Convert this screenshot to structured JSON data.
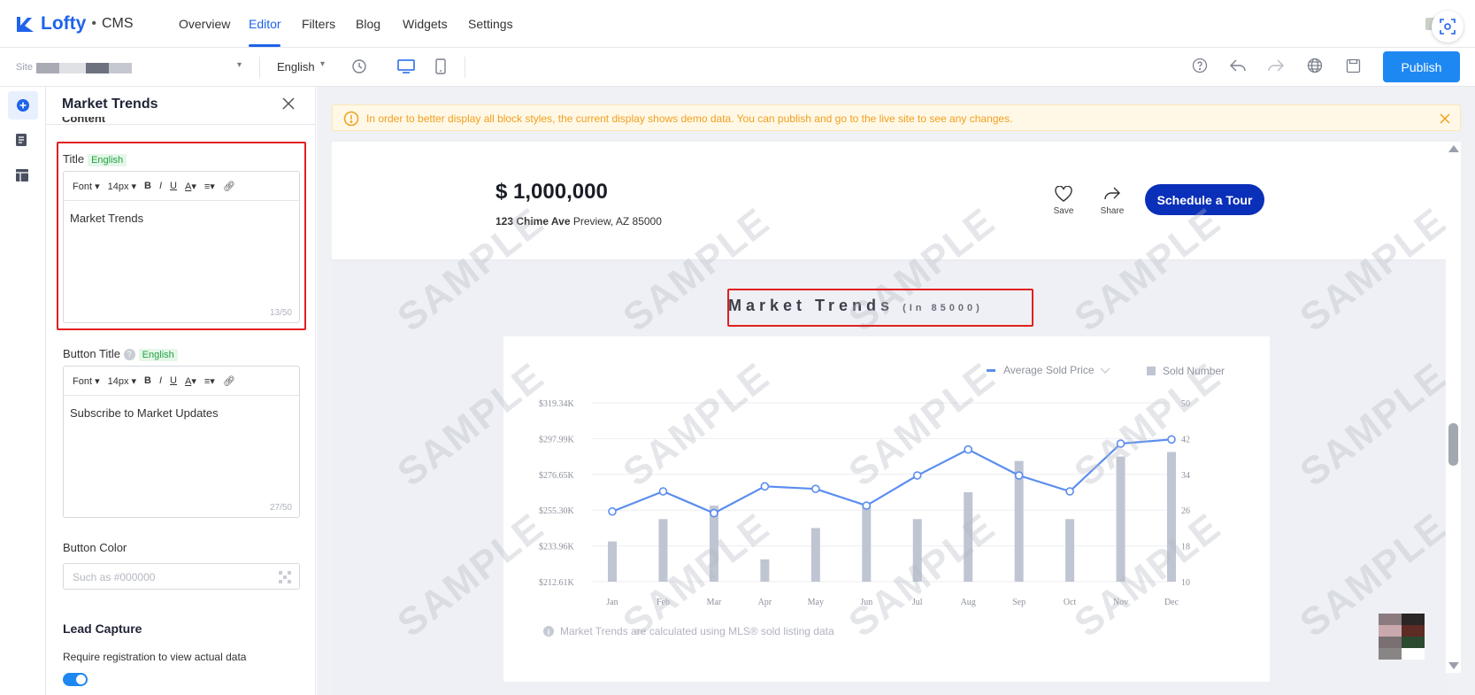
{
  "app": {
    "brand": "Lofty",
    "separator": "•",
    "product": "CMS"
  },
  "nav": {
    "tabs": [
      {
        "label": "Overview"
      },
      {
        "label": "Editor",
        "active": true
      },
      {
        "label": "Filters"
      },
      {
        "label": "Blog"
      },
      {
        "label": "Widgets"
      },
      {
        "label": "Settings"
      }
    ]
  },
  "toolbar": {
    "site_label": "Site",
    "language": "English",
    "publish_label": "Publish"
  },
  "panel": {
    "title": "Market Trends",
    "section_partial": "Content",
    "title_field": {
      "label": "Title",
      "lang_tag": "English",
      "value": "Market Trends",
      "count": "13/50"
    },
    "button_title_field": {
      "label": "Button Title",
      "lang_tag": "English",
      "value": "Subscribe to Market Updates",
      "count": "27/50"
    },
    "editor_toolbar": {
      "font": "Font",
      "size": "14px",
      "bold": "B",
      "italic": "I",
      "underline": "U",
      "color": "A"
    },
    "button_color": {
      "label": "Button Color",
      "placeholder": "Such as #000000"
    },
    "lead_capture": {
      "heading": "Lead Capture",
      "description": "Require registration to view actual data",
      "enabled": true
    }
  },
  "banner": {
    "text": "In order to better display all block styles, the current display shows demo data. You can publish and go to the live site to see any changes."
  },
  "property": {
    "price": "$ 1,000,000",
    "street": "123 Chime Ave",
    "city": "Preview, AZ 85000",
    "save_label": "Save",
    "share_label": "Share",
    "cta_label": "Schedule a Tour"
  },
  "section": {
    "title": "Market Trends",
    "subtitle": "(In 85000)"
  },
  "watermark": "SAMPLE",
  "footnote": "Market Trends are calculated using MLS® sold listing data",
  "colors": {
    "accent": "#1e63e9",
    "publish": "#1e88f2",
    "cta": "#0a2fb8",
    "line": "#5b8def",
    "bar": "#bfc5d2",
    "highlight": "#e02020",
    "banner_text": "#f0a020"
  },
  "chart_data": {
    "type": "bar+line",
    "categories": [
      "Jan",
      "Feb",
      "Mar",
      "Apr",
      "May",
      "Jun",
      "Jul",
      "Aug",
      "Sep",
      "Oct",
      "Nov",
      "Dec"
    ],
    "legend": [
      "Average Sold Price",
      "Sold Number"
    ],
    "left_axis_ticks": [
      "$319.34K",
      "$297.99K",
      "$276.65K",
      "$255.30K",
      "$233.96K",
      "$212.61K"
    ],
    "right_axis_ticks": [
      "50",
      "42",
      "34",
      "26",
      "18",
      "10"
    ],
    "left_ylim": [
      212.61,
      319.34
    ],
    "right_ylim": [
      10,
      50
    ],
    "series": [
      {
        "name": "Average Sold Price",
        "axis": "left",
        "type": "line",
        "values": [
          254.5,
          266.5,
          253.5,
          269.5,
          268.0,
          258.0,
          276.0,
          291.5,
          276.0,
          266.5,
          295.0,
          297.5
        ]
      },
      {
        "name": "Sold Number",
        "axis": "right",
        "type": "bar",
        "values": [
          19,
          24,
          27,
          15,
          22,
          27,
          24,
          30,
          37,
          24,
          38,
          39
        ]
      }
    ]
  }
}
